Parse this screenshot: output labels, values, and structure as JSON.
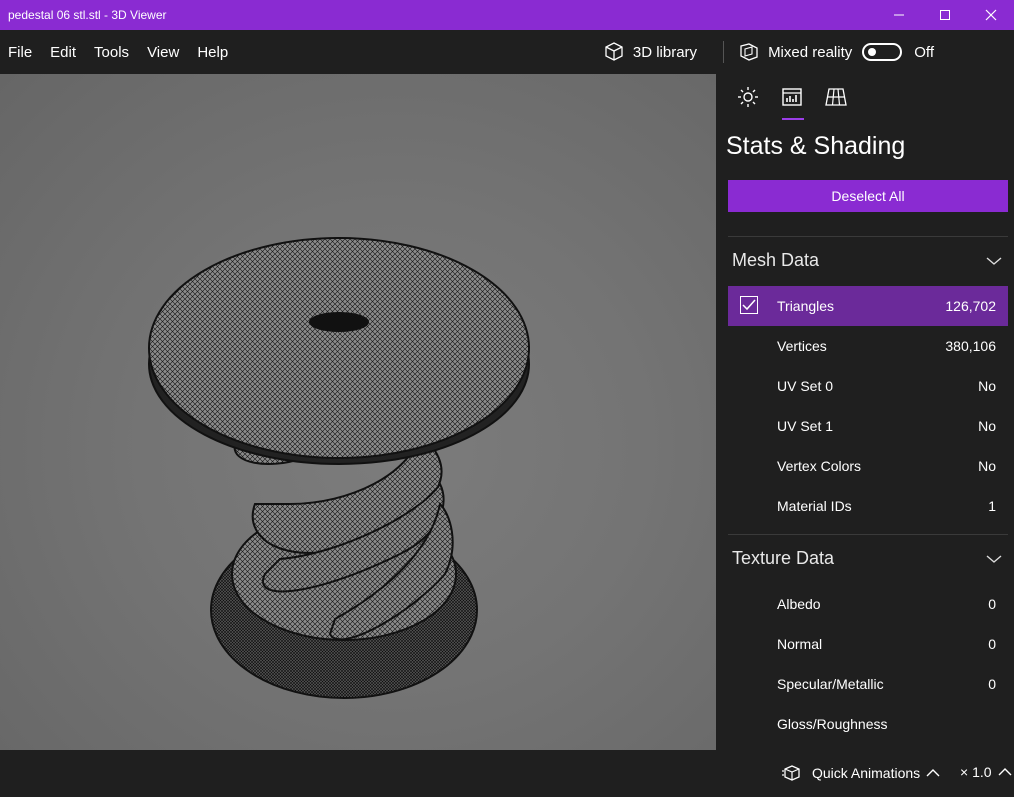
{
  "window": {
    "title": "pedestal 06 stl.stl - 3D Viewer"
  },
  "menu": {
    "items": [
      "File",
      "Edit",
      "Tools",
      "View",
      "Help"
    ]
  },
  "toolbar": {
    "library_label": "3D library",
    "mixed_reality_label": "Mixed reality",
    "mixed_reality_state": "Off"
  },
  "panel": {
    "tabs": [
      "lighting-tab",
      "stats-tab",
      "grid-tab"
    ],
    "active_tab": "stats-tab",
    "title": "Stats & Shading",
    "deselect_label": "Deselect All",
    "mesh": {
      "header": "Mesh Data",
      "rows": [
        {
          "name": "Triangles",
          "value": "126,702",
          "checked": true
        },
        {
          "name": "Vertices",
          "value": "380,106"
        },
        {
          "name": "UV Set 0",
          "value": "No"
        },
        {
          "name": "UV Set 1",
          "value": "No"
        },
        {
          "name": "Vertex Colors",
          "value": "No"
        },
        {
          "name": "Material IDs",
          "value": "1"
        }
      ]
    },
    "texture": {
      "header": "Texture Data",
      "rows": [
        {
          "name": "Albedo",
          "value": "0"
        },
        {
          "name": "Normal",
          "value": "0"
        },
        {
          "name": "Specular/Metallic",
          "value": "0"
        },
        {
          "name": "Gloss/Roughness",
          "value": ""
        }
      ]
    }
  },
  "status": {
    "quick_animations_label": "Quick Animations",
    "speed": "× 1.0"
  },
  "colors": {
    "accent": "#8a2bd2",
    "selected_row": "#6b2a9a",
    "background": "#1f1f1f"
  }
}
